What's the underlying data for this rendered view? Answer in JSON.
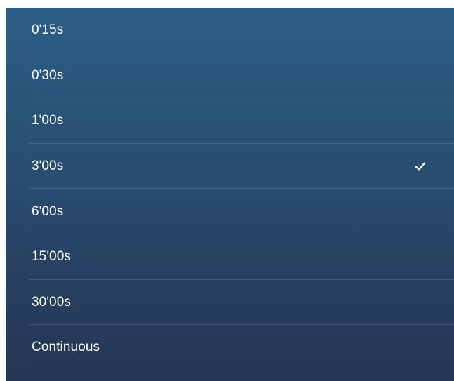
{
  "options": [
    {
      "label": "0'15s",
      "selected": false
    },
    {
      "label": "0'30s",
      "selected": false
    },
    {
      "label": "1'00s",
      "selected": false
    },
    {
      "label": "3'00s",
      "selected": true
    },
    {
      "label": "6'00s",
      "selected": false
    },
    {
      "label": "15'00s",
      "selected": false
    },
    {
      "label": "30'00s",
      "selected": false
    },
    {
      "label": "Continuous",
      "selected": false
    }
  ],
  "selected_icon": "checkmark-icon",
  "colors": {
    "text": "#ffffff",
    "gradient_top": "#2c5f86",
    "gradient_bottom": "#243753"
  }
}
